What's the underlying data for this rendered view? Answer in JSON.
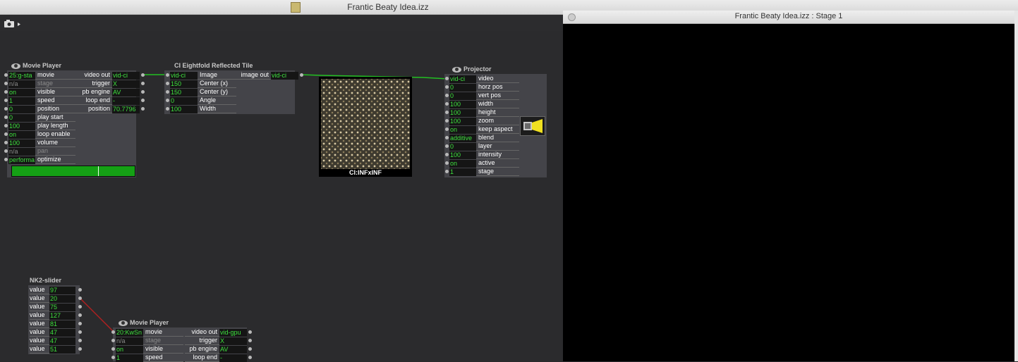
{
  "window": {
    "title": "Frantic Beaty Idea.izz"
  },
  "stage": {
    "title": "Frantic Beaty Idea.izz : Stage 1"
  },
  "movie_player_1": {
    "title": "Movie Player",
    "inputs": [
      {
        "value": "25:g-sta",
        "label": "movie"
      },
      {
        "value": "n/a",
        "label": "stage"
      },
      {
        "value": "on",
        "label": "visible"
      },
      {
        "value": "1",
        "label": "speed"
      },
      {
        "value": "0",
        "label": "position"
      },
      {
        "value": "0",
        "label": "play start"
      },
      {
        "value": "100",
        "label": "play length"
      },
      {
        "value": "on",
        "label": "loop enable"
      },
      {
        "value": "100",
        "label": "volume"
      },
      {
        "value": "n/a",
        "label": "pan"
      },
      {
        "value": "performa",
        "label": "optimize"
      }
    ],
    "outputs": [
      {
        "label": "video out",
        "value": "vid-ci"
      },
      {
        "label": "trigger",
        "value": "X"
      },
      {
        "label": "pb engine",
        "value": "AV"
      },
      {
        "label": "loop end",
        "value": "-"
      },
      {
        "label": "position",
        "value": "70.7796"
      }
    ],
    "progress": 0.7078
  },
  "ci_tile": {
    "title": "CI Eightfold Reflected Tile",
    "inputs": [
      {
        "value": "vid-ci",
        "label": "Image"
      },
      {
        "value": "150",
        "label": "Center (x)"
      },
      {
        "value": "150",
        "label": "Center (y)"
      },
      {
        "value": "0",
        "label": "Angle"
      },
      {
        "value": "100",
        "label": "Width"
      }
    ],
    "outputs": [
      {
        "label": "image out",
        "value": "vid-ci"
      }
    ]
  },
  "preview": {
    "label": "CI:INFxINF"
  },
  "projector": {
    "title": "Projector",
    "inputs": [
      {
        "value": "vid-ci",
        "label": "video"
      },
      {
        "value": "0",
        "label": "horz pos"
      },
      {
        "value": "0",
        "label": "vert pos"
      },
      {
        "value": "100",
        "label": "width"
      },
      {
        "value": "100",
        "label": "height"
      },
      {
        "value": "100",
        "label": "zoom"
      },
      {
        "value": "on",
        "label": "keep aspect"
      },
      {
        "value": "additive",
        "label": "blend"
      },
      {
        "value": "0",
        "label": "layer"
      },
      {
        "value": "100",
        "label": "intensity"
      },
      {
        "value": "on",
        "label": "active"
      },
      {
        "value": "1",
        "label": "stage"
      }
    ]
  },
  "nk2_slider": {
    "title": "NK2-slider",
    "rows": [
      {
        "label": "value",
        "value": "97"
      },
      {
        "label": "value",
        "value": "20"
      },
      {
        "label": "value",
        "value": "75"
      },
      {
        "label": "value",
        "value": "127"
      },
      {
        "label": "value",
        "value": "81"
      },
      {
        "label": "value",
        "value": "47"
      },
      {
        "label": "value",
        "value": "47"
      },
      {
        "label": "value",
        "value": "51"
      }
    ]
  },
  "movie_player_2": {
    "title": "Movie Player",
    "inputs": [
      {
        "value": "20:KwSn",
        "label": "movie"
      },
      {
        "value": "n/a",
        "label": "stage"
      },
      {
        "value": "on",
        "label": "visible"
      },
      {
        "value": "1",
        "label": "speed"
      }
    ],
    "outputs": [
      {
        "label": "video out",
        "value": "vid-gpu"
      },
      {
        "label": "trigger",
        "value": "X"
      },
      {
        "label": "pb engine",
        "value": "AV"
      },
      {
        "label": "loop end",
        "value": "-"
      }
    ]
  },
  "colors": {
    "cable_video": "#22c022",
    "cable_value": "#b02020",
    "value_text": "#3ee03e",
    "progress": "#16b016"
  }
}
